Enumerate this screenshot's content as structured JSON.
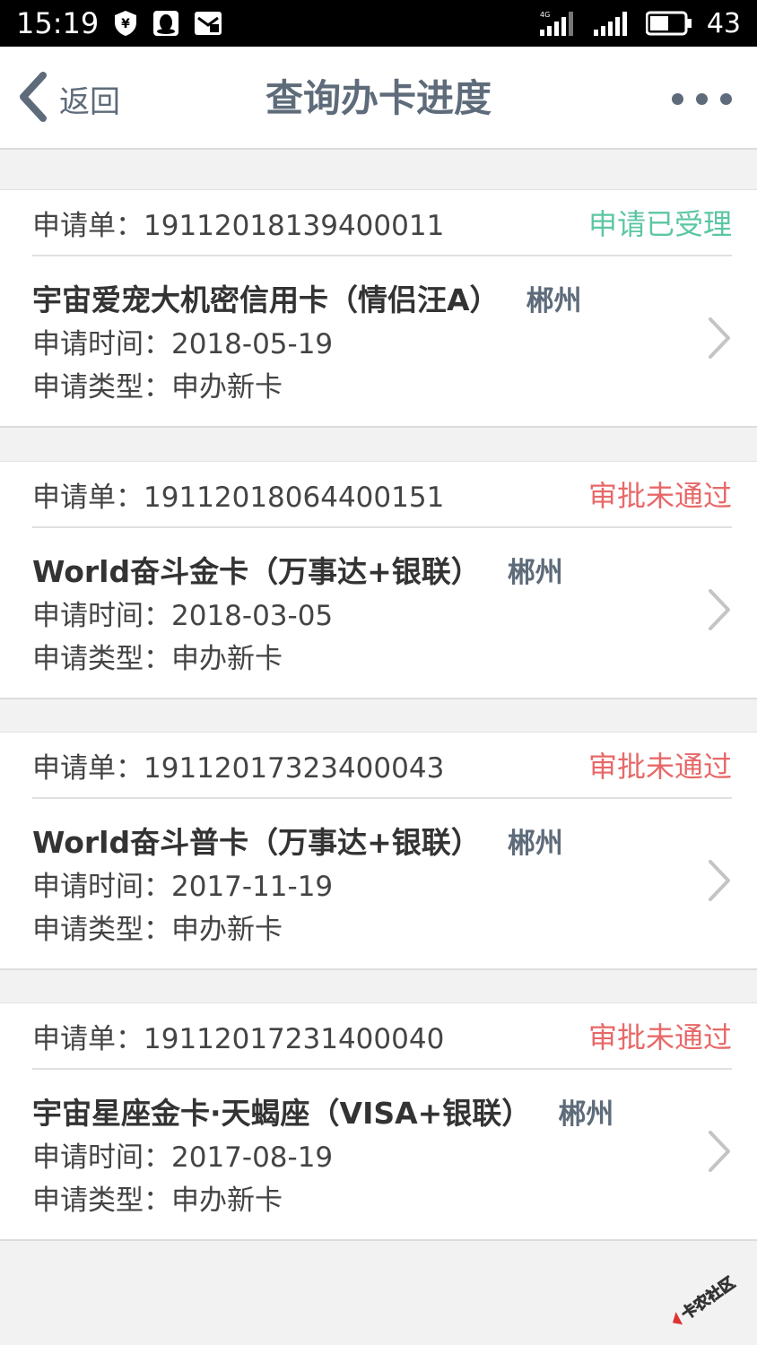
{
  "status_bar": {
    "time": "15:19",
    "battery": "43",
    "icons": [
      "yen-shield-icon",
      "qq-icon",
      "mail-icon",
      "signal-4g-icon",
      "signal-icon",
      "battery-icon"
    ]
  },
  "nav": {
    "back_label": "返回",
    "title": "查询办卡进度"
  },
  "applications": [
    {
      "order_label": "申请单：19112018139400011",
      "status": "申请已受理",
      "status_type": "accepted",
      "card_name": "宇宙爱宠大机密信用卡（情侣汪A）",
      "city": "郴州",
      "time_line": "申请时间：2018-05-19",
      "type_line": "申请类型：申办新卡"
    },
    {
      "order_label": "申请单：19112018064400151",
      "status": "审批未通过",
      "status_type": "rejected",
      "card_name": "World奋斗金卡（万事达+银联）",
      "city": "郴州",
      "time_line": "申请时间：2018-03-05",
      "type_line": "申请类型：申办新卡"
    },
    {
      "order_label": "申请单：19112017323400043",
      "status": "审批未通过",
      "status_type": "rejected",
      "card_name": "World奋斗普卡（万事达+银联）",
      "city": "郴州",
      "time_line": "申请时间：2017-11-19",
      "type_line": "申请类型：申办新卡"
    },
    {
      "order_label": "申请单：19112017231400040",
      "status": "审批未通过",
      "status_type": "rejected",
      "card_name": "宇宙星座金卡·天蝎座（VISA+银联）",
      "city": "郴州",
      "time_line": "申请时间：2017-08-19",
      "type_line": "申请类型：申办新卡"
    }
  ],
  "watermark": "卡农社区",
  "colors": {
    "accepted": "#5cc6a4",
    "rejected": "#e86868",
    "nav_text": "#5e6b7a",
    "background": "#f2f2f2"
  }
}
